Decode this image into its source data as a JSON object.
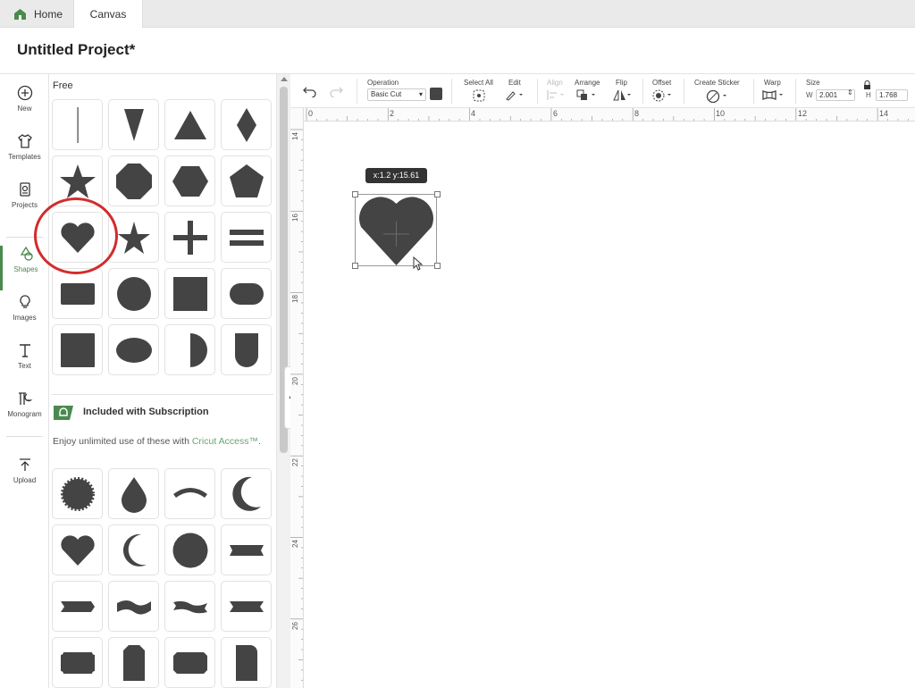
{
  "tabs": {
    "home": "Home",
    "canvas": "Canvas"
  },
  "project": {
    "title": "Untitled Project*"
  },
  "leftnav": {
    "items": [
      {
        "label": "New",
        "icon": "plus-circle-icon"
      },
      {
        "label": "Templates",
        "icon": "shirt-icon"
      },
      {
        "label": "Projects",
        "icon": "projects-icon"
      },
      {
        "label": "Shapes",
        "icon": "shapes-icon"
      },
      {
        "label": "Images",
        "icon": "lightbulb-icon"
      },
      {
        "label": "Text",
        "icon": "text-icon"
      },
      {
        "label": "Monogram",
        "icon": "monogram-icon"
      },
      {
        "label": "Upload",
        "icon": "upload-icon"
      }
    ],
    "active": "Shapes"
  },
  "panel": {
    "free_label": "Free",
    "free_shapes": [
      "line",
      "triangle-down",
      "triangle",
      "diamond",
      "star",
      "octagon",
      "hexagon",
      "pentagon",
      "heart",
      "star-narrow",
      "plus",
      "equals",
      "rounded-rectangle",
      "circle",
      "square",
      "rounded-pill",
      "square-large",
      "oval",
      "half-circle",
      "u-shape"
    ],
    "subscription_title": "Included with Subscription",
    "subscription_desc": "Enjoy unlimited use of these with ",
    "subscription_link": "Cricut Access™",
    "subscription_period": ".",
    "sub_shapes": [
      "starburst",
      "drop",
      "arc",
      "crescent",
      "heart",
      "crescent-thin",
      "scalloped-circle",
      "banner-notched",
      "ribbon-arrow",
      "ribbon-wave",
      "ribbon-wave-tails",
      "ribbon-bow",
      "ticket",
      "tag",
      "ticket-notched",
      "rounded-tab"
    ]
  },
  "toolbar": {
    "operation_label": "Operation",
    "operation_value": "Basic Cut",
    "select_all_label": "Select All",
    "edit_label": "Edit",
    "align_label": "Align",
    "arrange_label": "Arrange",
    "flip_label": "Flip",
    "offset_label": "Offset",
    "create_sticker_label": "Create Sticker",
    "warp_label": "Warp",
    "size_label": "Size",
    "width_label": "W",
    "width_value": "2.001",
    "height_label": "H",
    "height_value": "1.768"
  },
  "ruler": {
    "h_labels": [
      "0",
      "2",
      "4",
      "6",
      "8",
      "10",
      "12",
      "14"
    ],
    "v_labels": [
      "14",
      "16",
      "18",
      "20",
      "22",
      "24",
      "26"
    ]
  },
  "canvas": {
    "coord_tooltip": "x:1.2 y:15.61"
  },
  "colors": {
    "shape_fill": "#444444",
    "accent": "#4a8a4f",
    "annotation": "#d22c2c"
  }
}
